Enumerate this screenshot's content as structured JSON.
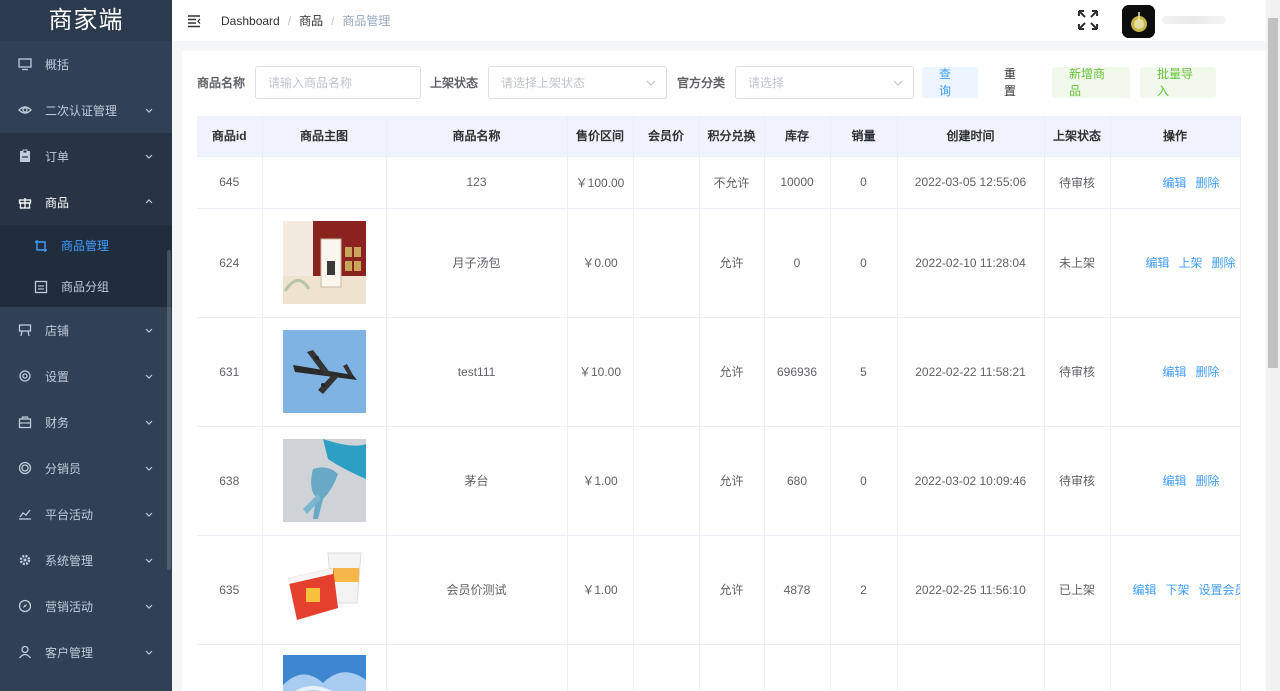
{
  "app": {
    "logo": "商家端"
  },
  "sidebar": {
    "items": [
      {
        "label": "概括",
        "icon": "monitor-icon",
        "has_children": false
      },
      {
        "label": "二次认证管理",
        "icon": "eye-icon",
        "has_children": true
      },
      {
        "label": "订单",
        "icon": "clipboard-icon",
        "has_children": true
      },
      {
        "label": "商品",
        "icon": "gift-icon",
        "has_children": true,
        "expanded": true
      },
      {
        "label": "店铺",
        "icon": "shop-icon",
        "has_children": true
      },
      {
        "label": "设置",
        "icon": "gear-icon",
        "has_children": true
      },
      {
        "label": "财务",
        "icon": "wallet-icon",
        "has_children": true
      },
      {
        "label": "分销员",
        "icon": "distributor-icon",
        "has_children": true
      },
      {
        "label": "平台活动",
        "icon": "chart-icon",
        "has_children": true
      },
      {
        "label": "系统管理",
        "icon": "system-gear-icon",
        "has_children": true
      },
      {
        "label": "营销活动",
        "icon": "compass-icon",
        "has_children": true
      },
      {
        "label": "客户管理",
        "icon": "user-icon",
        "has_children": true
      }
    ],
    "sub_items": [
      {
        "label": "商品管理",
        "icon": "crop-icon",
        "active": true
      },
      {
        "label": "商品分组",
        "icon": "picture-icon",
        "active": false
      }
    ]
  },
  "header": {
    "breadcrumb": [
      "Dashboard",
      "商品",
      "商品管理"
    ],
    "separator": "/"
  },
  "filters": {
    "name_label": "商品名称",
    "name_placeholder": "请输入商品名称",
    "status_label": "上架状态",
    "status_placeholder": "请选择上架状态",
    "category_label": "官方分类",
    "category_placeholder": "请选择",
    "query_button": "查询",
    "reset_button": "重置",
    "add_button": "新增商品",
    "import_button": "批量导入"
  },
  "table": {
    "headers": [
      "商品id",
      "商品主图",
      "商品名称",
      "售价区间",
      "会员价",
      "积分兑换",
      "库存",
      "销量",
      "创建时间",
      "上架状态",
      "操作"
    ],
    "rows": [
      {
        "id": "645",
        "image": "",
        "name": "123",
        "price": "￥100.00",
        "member_price": "",
        "points": "不允许",
        "stock": "10000",
        "sales": "0",
        "created": "2022-03-05 12:55:06",
        "status": "待审核",
        "ops": [
          "编辑",
          "删除"
        ]
      },
      {
        "id": "624",
        "image": "product-box-image",
        "name": "月子汤包",
        "price": "￥0.00",
        "member_price": "",
        "points": "允许",
        "stock": "0",
        "sales": "0",
        "created": "2022-02-10 11:28:04",
        "status": "未上架",
        "ops": [
          "编辑",
          "上架",
          "删除"
        ]
      },
      {
        "id": "631",
        "image": "airplane-image",
        "name": "test111",
        "price": "￥10.00",
        "member_price": "",
        "points": "允许",
        "stock": "696936",
        "sales": "5",
        "created": "2022-02-22 11:58:21",
        "status": "待审核",
        "ops": [
          "编辑",
          "删除"
        ]
      },
      {
        "id": "638",
        "image": "splash-figure-image",
        "name": "茅台",
        "price": "￥1.00",
        "member_price": "",
        "points": "允许",
        "stock": "680",
        "sales": "0",
        "created": "2022-03-02 10:09:46",
        "status": "待审核",
        "ops": [
          "编辑",
          "删除"
        ]
      },
      {
        "id": "635",
        "image": "paper-cups-image",
        "name": "会员价测试",
        "price": "￥1.00",
        "member_price": "",
        "points": "允许",
        "stock": "4878",
        "sales": "2",
        "created": "2022-02-25 11:56:10",
        "status": "已上架",
        "ops": [
          "编辑",
          "下架",
          "设置会员价"
        ]
      }
    ]
  }
}
